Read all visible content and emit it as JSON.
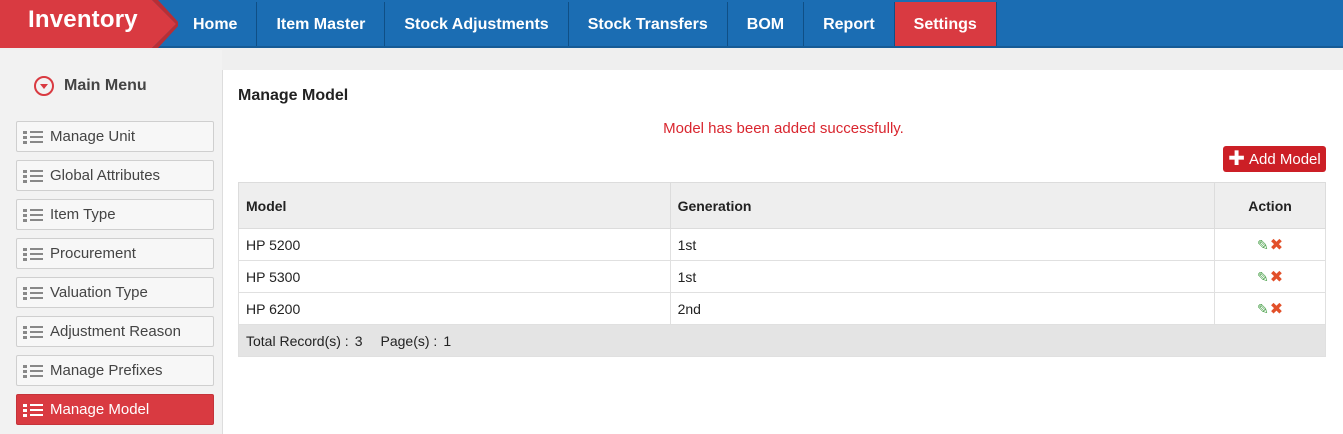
{
  "app": {
    "brand": "Inventory"
  },
  "nav": {
    "items": [
      {
        "label": "Home"
      },
      {
        "label": "Item Master"
      },
      {
        "label": "Stock Adjustments"
      },
      {
        "label": "Stock Transfers"
      },
      {
        "label": "BOM"
      },
      {
        "label": "Report"
      },
      {
        "label": "Settings"
      }
    ],
    "active": "Settings"
  },
  "sidebar": {
    "heading": "Main Menu",
    "items": [
      {
        "label": "Manage Unit"
      },
      {
        "label": "Global Attributes"
      },
      {
        "label": "Item Type"
      },
      {
        "label": "Procurement"
      },
      {
        "label": "Valuation Type"
      },
      {
        "label": "Adjustment Reason"
      },
      {
        "label": "Manage Prefixes"
      },
      {
        "label": "Manage Model"
      }
    ],
    "active": "Manage Model"
  },
  "main": {
    "title": "Manage Model",
    "success_message": "Model has been added successfully.",
    "add_button": "Add Model",
    "table": {
      "columns": [
        "Model",
        "Generation",
        "Action"
      ],
      "rows": [
        {
          "model": "HP 5200",
          "generation": "1st"
        },
        {
          "model": "HP 5300",
          "generation": "1st"
        },
        {
          "model": "HP 6200",
          "generation": "2nd"
        }
      ],
      "footer": {
        "total_label": "Total Record(s) :",
        "total_value": "3",
        "pages_label": "Page(s) :",
        "pages_value": "1"
      }
    }
  },
  "colors": {
    "nav_bg": "#1b6db3",
    "accent_red": "#d93a41",
    "success_text": "#d9262f",
    "edit_icon": "#4aa04a",
    "delete_icon": "#e2502a"
  }
}
